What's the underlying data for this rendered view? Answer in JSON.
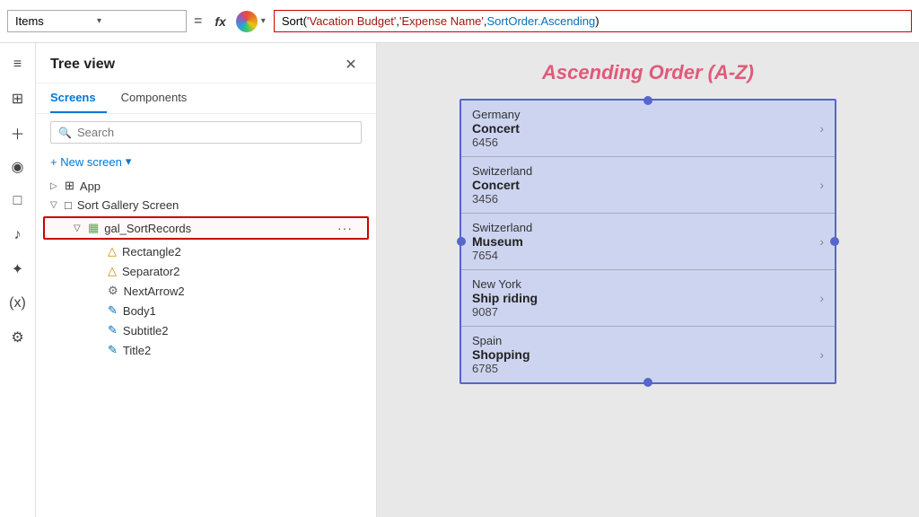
{
  "topbar": {
    "property_label": "Items",
    "equals": "=",
    "fx": "fx",
    "formula": "Sort('Vacation Budget','Expense Name',SortOrder.Ascending)",
    "formula_parts": [
      {
        "text": "Sort(",
        "class": "f-black"
      },
      {
        "text": "'Vacation Budget'",
        "class": "f-red"
      },
      {
        "text": ",",
        "class": "f-black"
      },
      {
        "text": "'Expense Name'",
        "class": "f-red"
      },
      {
        "text": ",",
        "class": "f-black"
      },
      {
        "text": "SortOrder.Ascending",
        "class": "f-blue"
      },
      {
        "text": ")",
        "class": "f-black"
      }
    ]
  },
  "sidebar_icons": [
    "≡",
    "⊞",
    "+",
    "◉",
    "□",
    "♪",
    "✦",
    "(x)",
    "⚙"
  ],
  "tree": {
    "title": "Tree view",
    "tabs": [
      {
        "label": "Screens",
        "active": true
      },
      {
        "label": "Components",
        "active": false
      }
    ],
    "search_placeholder": "Search",
    "new_screen_label": "+ New screen",
    "items": [
      {
        "indent": 0,
        "expand": "▷",
        "icon": "□",
        "label": "App",
        "more": "",
        "selected": false
      },
      {
        "indent": 0,
        "expand": "▽",
        "icon": "□",
        "label": "Sort Gallery Screen",
        "more": "",
        "selected": false
      },
      {
        "indent": 1,
        "expand": "▽",
        "icon": "▦",
        "label": "gal_SortRecords",
        "more": "···",
        "selected": true
      },
      {
        "indent": 2,
        "expand": "",
        "icon": "△",
        "label": "Rectangle2",
        "more": "",
        "selected": false
      },
      {
        "indent": 2,
        "expand": "",
        "icon": "△",
        "label": "Separator2",
        "more": "",
        "selected": false
      },
      {
        "indent": 2,
        "expand": "",
        "icon": "⚙",
        "label": "NextArrow2",
        "more": "",
        "selected": false
      },
      {
        "indent": 2,
        "expand": "",
        "icon": "✎",
        "label": "Body1",
        "more": "",
        "selected": false
      },
      {
        "indent": 2,
        "expand": "",
        "icon": "✎",
        "label": "Subtitle2",
        "more": "",
        "selected": false
      },
      {
        "indent": 2,
        "expand": "",
        "icon": "✎",
        "label": "Title2",
        "more": "",
        "selected": false
      }
    ]
  },
  "canvas": {
    "title": "Ascending Order (A-Z)",
    "gallery_rows": [
      {
        "country": "Germany",
        "expense": "Concert",
        "amount": "6456"
      },
      {
        "country": "Switzerland",
        "expense": "Concert",
        "amount": "3456"
      },
      {
        "country": "Switzerland",
        "expense": "Museum",
        "amount": "7654"
      },
      {
        "country": "New York",
        "expense": "Ship riding",
        "amount": "9087"
      },
      {
        "country": "Spain",
        "expense": "Shopping",
        "amount": "6785"
      }
    ]
  }
}
